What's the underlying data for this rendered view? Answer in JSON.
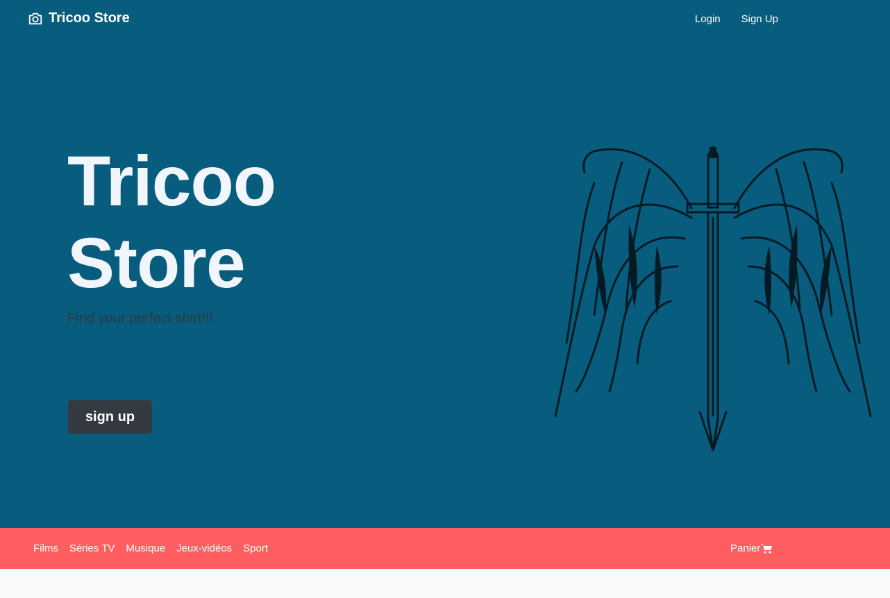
{
  "navbar": {
    "brand": "Tricoo Store",
    "brand_icon": "camera-icon",
    "links": [
      "Login",
      "Sign Up"
    ]
  },
  "hero": {
    "title": "Tricoo Store",
    "subtitle": "Find your perfect shirt!!!",
    "button_label": "sign up",
    "art_icon": "winged-sword-illustration"
  },
  "categories": {
    "items": [
      "Films",
      "Séries TV",
      "Musique",
      "Jeux-vidéos",
      "Sport"
    ],
    "cart_label": "Panier",
    "cart_icon": "shopping-cart-icon"
  },
  "colors": {
    "primary": "#085d7e",
    "accent": "#ff5e61",
    "button": "#343a40"
  }
}
